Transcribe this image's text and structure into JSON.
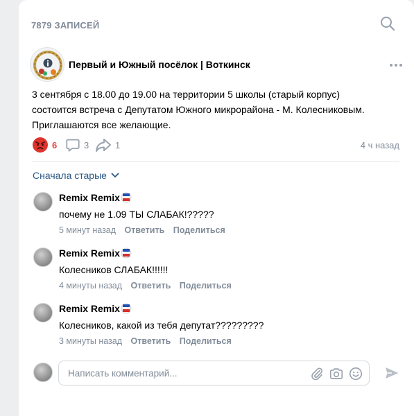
{
  "feed": {
    "header": "7879 ЗАПИСЕЙ",
    "search_icon": "search-icon"
  },
  "post": {
    "group_name": "Первый и Южный посёлок | Воткинск",
    "more_icon": "more-horizontal-icon",
    "text_lines": [
      "3 сентября с 18.00 до 19.00 на территории 5 школы (старый корпус)",
      "состоится встреча с Депутатом Южного микрорайона - М. Колесниковым.",
      "Приглашаются все желающие."
    ],
    "reactions_count": "6",
    "comments_count": "3",
    "shares_count": "1",
    "time": "4 ч назад"
  },
  "comments_section": {
    "sort_label": "Сначала старые",
    "items": [
      {
        "author": "Remix Remix",
        "text": "почему не 1.09 ТЫ СЛАБАК!?????",
        "time": "5 минут назад",
        "reply": "Ответить",
        "share": "Поделиться"
      },
      {
        "author": "Remix Remix",
        "text": "Колесников СЛАБАК!!!!!!",
        "time": "4 минуты назад",
        "reply": "Ответить",
        "share": "Поделиться"
      },
      {
        "author": "Remix Remix",
        "text": "Колесников, какой из тебя депутат?????????",
        "time": "3 минуты назад",
        "reply": "Ответить",
        "share": "Поделиться"
      }
    ]
  },
  "composer": {
    "placeholder": "Написать комментарий..."
  },
  "colors": {
    "link": "#2a5885",
    "muted": "#818c99",
    "icon": "#99a2ad",
    "reaction": "#e64646"
  }
}
